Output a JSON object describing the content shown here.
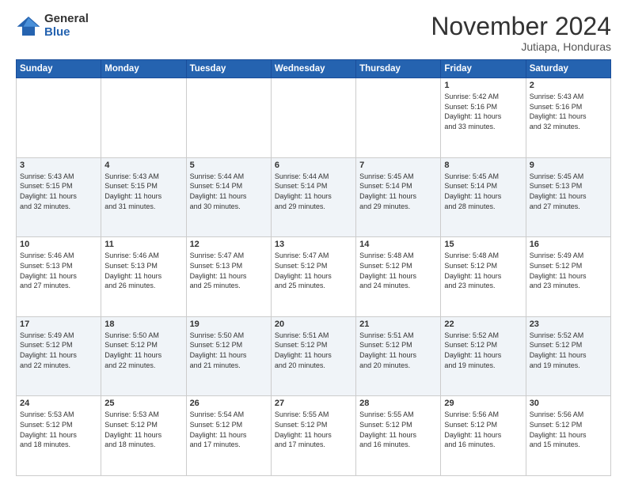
{
  "logo": {
    "line1": "General",
    "line2": "Blue"
  },
  "header": {
    "month": "November 2024",
    "location": "Jutiapa, Honduras"
  },
  "weekdays": [
    "Sunday",
    "Monday",
    "Tuesday",
    "Wednesday",
    "Thursday",
    "Friday",
    "Saturday"
  ],
  "weeks": [
    [
      {
        "day": "",
        "info": ""
      },
      {
        "day": "",
        "info": ""
      },
      {
        "day": "",
        "info": ""
      },
      {
        "day": "",
        "info": ""
      },
      {
        "day": "",
        "info": ""
      },
      {
        "day": "1",
        "info": "Sunrise: 5:42 AM\nSunset: 5:16 PM\nDaylight: 11 hours\nand 33 minutes."
      },
      {
        "day": "2",
        "info": "Sunrise: 5:43 AM\nSunset: 5:16 PM\nDaylight: 11 hours\nand 32 minutes."
      }
    ],
    [
      {
        "day": "3",
        "info": "Sunrise: 5:43 AM\nSunset: 5:15 PM\nDaylight: 11 hours\nand 32 minutes."
      },
      {
        "day": "4",
        "info": "Sunrise: 5:43 AM\nSunset: 5:15 PM\nDaylight: 11 hours\nand 31 minutes."
      },
      {
        "day": "5",
        "info": "Sunrise: 5:44 AM\nSunset: 5:14 PM\nDaylight: 11 hours\nand 30 minutes."
      },
      {
        "day": "6",
        "info": "Sunrise: 5:44 AM\nSunset: 5:14 PM\nDaylight: 11 hours\nand 29 minutes."
      },
      {
        "day": "7",
        "info": "Sunrise: 5:45 AM\nSunset: 5:14 PM\nDaylight: 11 hours\nand 29 minutes."
      },
      {
        "day": "8",
        "info": "Sunrise: 5:45 AM\nSunset: 5:14 PM\nDaylight: 11 hours\nand 28 minutes."
      },
      {
        "day": "9",
        "info": "Sunrise: 5:45 AM\nSunset: 5:13 PM\nDaylight: 11 hours\nand 27 minutes."
      }
    ],
    [
      {
        "day": "10",
        "info": "Sunrise: 5:46 AM\nSunset: 5:13 PM\nDaylight: 11 hours\nand 27 minutes."
      },
      {
        "day": "11",
        "info": "Sunrise: 5:46 AM\nSunset: 5:13 PM\nDaylight: 11 hours\nand 26 minutes."
      },
      {
        "day": "12",
        "info": "Sunrise: 5:47 AM\nSunset: 5:13 PM\nDaylight: 11 hours\nand 25 minutes."
      },
      {
        "day": "13",
        "info": "Sunrise: 5:47 AM\nSunset: 5:12 PM\nDaylight: 11 hours\nand 25 minutes."
      },
      {
        "day": "14",
        "info": "Sunrise: 5:48 AM\nSunset: 5:12 PM\nDaylight: 11 hours\nand 24 minutes."
      },
      {
        "day": "15",
        "info": "Sunrise: 5:48 AM\nSunset: 5:12 PM\nDaylight: 11 hours\nand 23 minutes."
      },
      {
        "day": "16",
        "info": "Sunrise: 5:49 AM\nSunset: 5:12 PM\nDaylight: 11 hours\nand 23 minutes."
      }
    ],
    [
      {
        "day": "17",
        "info": "Sunrise: 5:49 AM\nSunset: 5:12 PM\nDaylight: 11 hours\nand 22 minutes."
      },
      {
        "day": "18",
        "info": "Sunrise: 5:50 AM\nSunset: 5:12 PM\nDaylight: 11 hours\nand 22 minutes."
      },
      {
        "day": "19",
        "info": "Sunrise: 5:50 AM\nSunset: 5:12 PM\nDaylight: 11 hours\nand 21 minutes."
      },
      {
        "day": "20",
        "info": "Sunrise: 5:51 AM\nSunset: 5:12 PM\nDaylight: 11 hours\nand 20 minutes."
      },
      {
        "day": "21",
        "info": "Sunrise: 5:51 AM\nSunset: 5:12 PM\nDaylight: 11 hours\nand 20 minutes."
      },
      {
        "day": "22",
        "info": "Sunrise: 5:52 AM\nSunset: 5:12 PM\nDaylight: 11 hours\nand 19 minutes."
      },
      {
        "day": "23",
        "info": "Sunrise: 5:52 AM\nSunset: 5:12 PM\nDaylight: 11 hours\nand 19 minutes."
      }
    ],
    [
      {
        "day": "24",
        "info": "Sunrise: 5:53 AM\nSunset: 5:12 PM\nDaylight: 11 hours\nand 18 minutes."
      },
      {
        "day": "25",
        "info": "Sunrise: 5:53 AM\nSunset: 5:12 PM\nDaylight: 11 hours\nand 18 minutes."
      },
      {
        "day": "26",
        "info": "Sunrise: 5:54 AM\nSunset: 5:12 PM\nDaylight: 11 hours\nand 17 minutes."
      },
      {
        "day": "27",
        "info": "Sunrise: 5:55 AM\nSunset: 5:12 PM\nDaylight: 11 hours\nand 17 minutes."
      },
      {
        "day": "28",
        "info": "Sunrise: 5:55 AM\nSunset: 5:12 PM\nDaylight: 11 hours\nand 16 minutes."
      },
      {
        "day": "29",
        "info": "Sunrise: 5:56 AM\nSunset: 5:12 PM\nDaylight: 11 hours\nand 16 minutes."
      },
      {
        "day": "30",
        "info": "Sunrise: 5:56 AM\nSunset: 5:12 PM\nDaylight: 11 hours\nand 15 minutes."
      }
    ]
  ]
}
